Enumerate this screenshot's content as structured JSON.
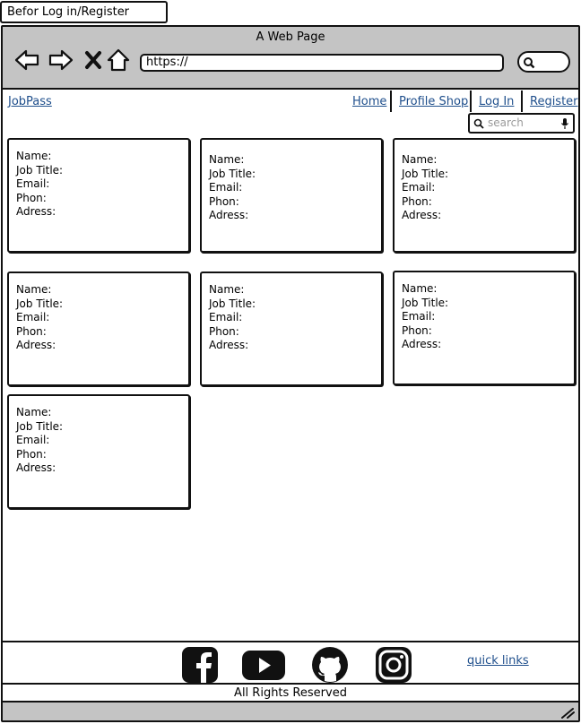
{
  "page_label": "Befor Log in/Register",
  "window": {
    "title": "A Web Page"
  },
  "address_bar": {
    "value": "https://"
  },
  "site": {
    "brand": "JobPass",
    "nav": {
      "home": "Home",
      "profile_shop": "Profile Shop",
      "log_in": "Log In",
      "register": "Register"
    },
    "search": {
      "placeholder": "search"
    }
  },
  "cards": [
    {
      "name": "Name:",
      "job_title": "Job Title:",
      "email": "Email:",
      "phone": "Phon:",
      "address": "Adress:"
    },
    {
      "name": "Name:",
      "job_title": "Job Title:",
      "email": "Email:",
      "phone": "Phon:",
      "address": "Adress:"
    },
    {
      "name": "Name:",
      "job_title": "Job Title:",
      "email": "Email:",
      "phone": "Phon:",
      "address": "Adress:"
    },
    {
      "name": "Name:",
      "job_title": "Job Title:",
      "email": "Email:",
      "phone": "Phon:",
      "address": "Adress:"
    },
    {
      "name": "Name:",
      "job_title": "Job Title:",
      "email": "Email:",
      "phone": "Phon:",
      "address": "Adress:"
    },
    {
      "name": "Name:",
      "job_title": "Job Title:",
      "email": "Email:",
      "phone": "Phon:",
      "address": "Adress:"
    },
    {
      "name": "Name:",
      "job_title": "Job Title:",
      "email": "Email:",
      "phone": "Phon:",
      "address": "Adress:"
    }
  ],
  "footer": {
    "social_icons": [
      "facebook-icon",
      "youtube-icon",
      "github-icon",
      "instagram-icon"
    ],
    "quick_links": "quick links",
    "copyright": "All Rights Reserved"
  },
  "colors": {
    "chrome": "#c4c4c4",
    "link": "#1f4f8c",
    "stroke": "#111111"
  }
}
